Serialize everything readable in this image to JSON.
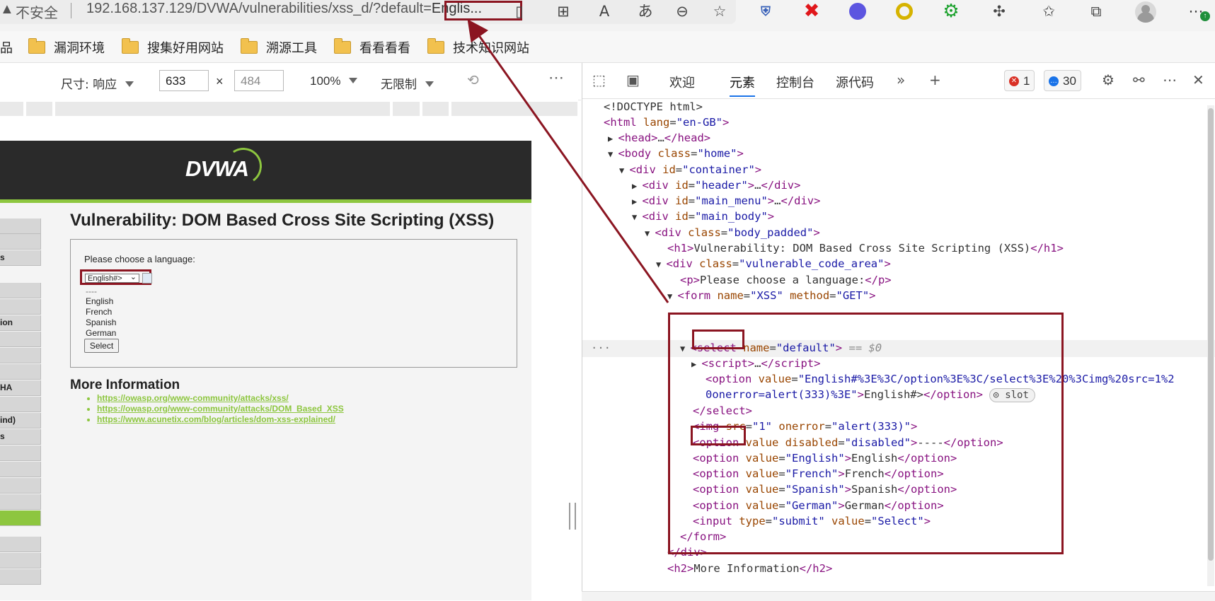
{
  "browser": {
    "security_label": "不安全",
    "url_main": "192.168.137.129/DVWA/vulnerabilities/xss_d/?default=",
    "url_truncated": "Englis...",
    "bookmarks": [
      "品",
      "漏洞环境",
      "搜集好用网站",
      "溯源工具",
      "看看看看",
      "技术知识网站"
    ]
  },
  "device_toolbar": {
    "dimensions_label": "尺寸: 响应",
    "width": "633",
    "height_placeholder": "484",
    "times": "×",
    "zoom": "100%",
    "throttle": "无限制"
  },
  "dvwa": {
    "logo": "DVWA",
    "title": "Vulnerability: DOM Based Cross Site Scripting (XSS)",
    "prompt": "Please choose a language:",
    "select_value": "English#>",
    "options": [
      "----",
      "English",
      "French",
      "Spanish",
      "German"
    ],
    "submit_label": "Select",
    "more_info_title": "More Information",
    "links": [
      "https://owasp.org/www-community/attacks/xss/",
      "https://owasp.org/www-community/attacks/DOM_Based_XSS",
      "https://www.acunetix.com/blog/articles/dom-xss-explained/"
    ],
    "menu_fragments": [
      "",
      "",
      "s",
      "",
      "",
      "ion",
      "",
      "",
      "",
      "HA",
      "",
      "ind)",
      "s",
      "",
      "",
      "",
      "",
      "",
      "",
      "",
      ""
    ]
  },
  "devtools": {
    "tabs": [
      "欢迎",
      "元素",
      "控制台",
      "源代码"
    ],
    "active_tab": "元素",
    "error_count": "1",
    "message_count": "30",
    "slot_label": "slot",
    "selected_marker": "== $0"
  },
  "colors": {
    "annotation_red": "#8b1521",
    "dvwa_green": "#8dc63f",
    "tag_purple": "#881280",
    "attr_name": "#994500",
    "attr_value": "#1a1aa6"
  }
}
